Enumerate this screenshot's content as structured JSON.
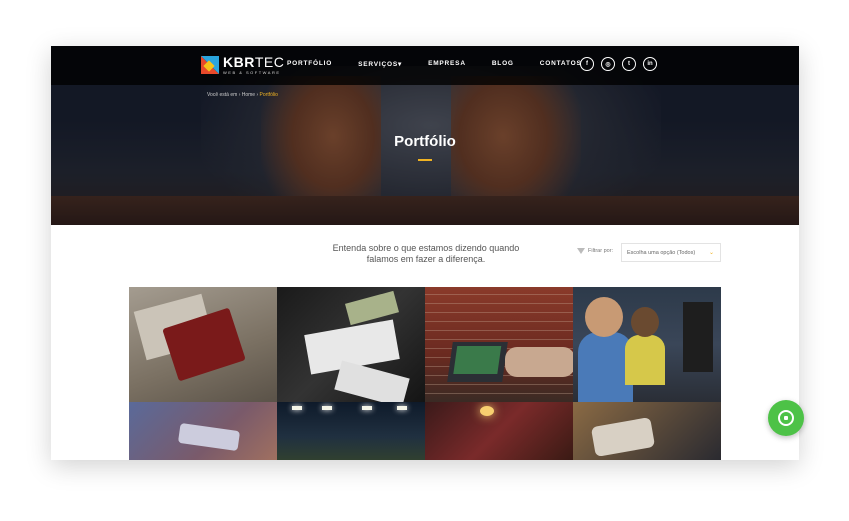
{
  "logo": {
    "brand_bold": "KBR",
    "brand_light": "TEC",
    "tagline": "WEB & SOFTWARE"
  },
  "nav": {
    "items": [
      {
        "label": "PORTFÓLIO"
      },
      {
        "label": "SERVIÇOS▾"
      },
      {
        "label": "EMPRESA"
      },
      {
        "label": "BLOG"
      },
      {
        "label": "CONTATOS"
      }
    ],
    "social": [
      {
        "icon": "facebook-icon",
        "glyph": "f"
      },
      {
        "icon": "instagram-icon",
        "glyph": "◎"
      },
      {
        "icon": "twitter-icon",
        "glyph": "t"
      },
      {
        "icon": "linkedin-icon",
        "glyph": "in"
      }
    ]
  },
  "breadcrumb": {
    "prefix": "Você está em",
    "sep1": "›",
    "home": "Home",
    "sep2": "›",
    "current": "Portfólio"
  },
  "hero": {
    "title": "Portfólio"
  },
  "intro": {
    "text": "Entenda sobre o que estamos dizendo quando falamos em fazer a diferença."
  },
  "filter": {
    "label": "Filtrar por:",
    "selected": "Escolha uma opção (Todos)",
    "chevron": "⌄"
  },
  "portfolio": {
    "items": 8
  },
  "colors": {
    "accent": "#f0b323",
    "whatsapp": "#4dc247",
    "nav_bg": "#000000"
  },
  "whatsapp": {
    "icon": "whatsapp-icon"
  }
}
